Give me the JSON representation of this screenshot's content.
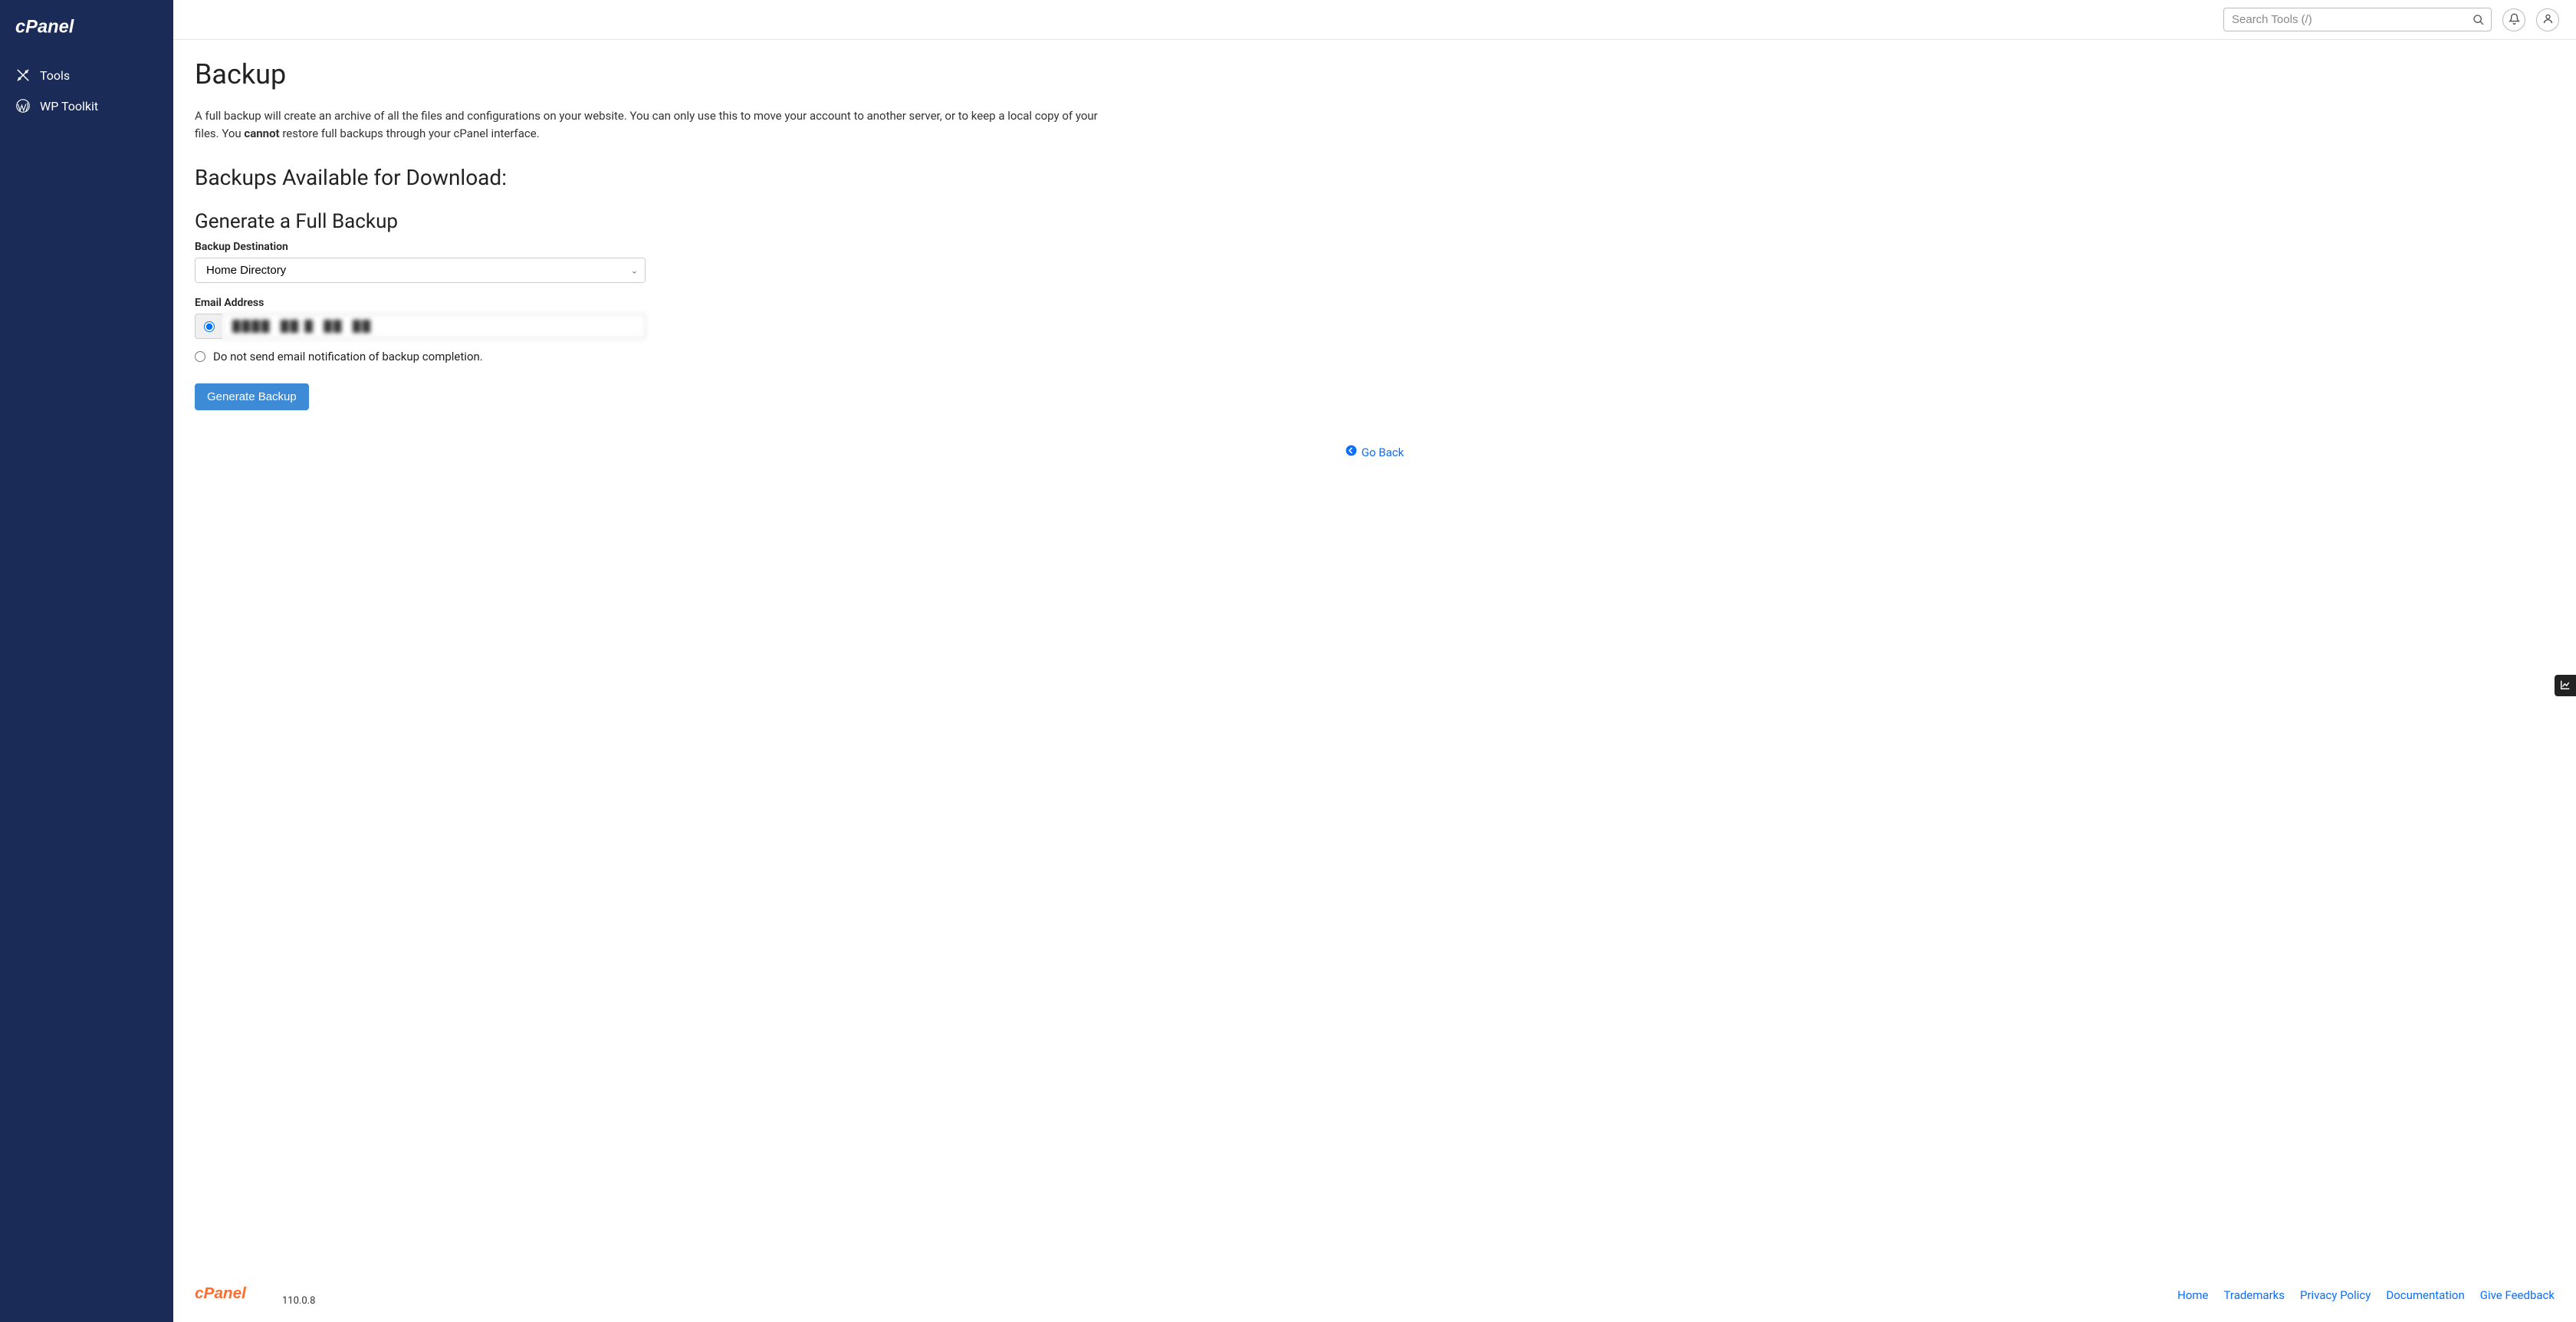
{
  "sidebar": {
    "items": [
      {
        "label": "Tools"
      },
      {
        "label": "WP Toolkit"
      }
    ]
  },
  "topbar": {
    "search_placeholder": "Search Tools (/)"
  },
  "page": {
    "title": "Backup",
    "description_prefix": "A full backup will create an archive of all the files and configurations on your website. You can only use this to move your account to another server, or to keep a local copy of your files. You ",
    "description_bold": "cannot",
    "description_suffix": " restore full backups through your cPanel interface.",
    "section_backups_available": "Backups Available for Download:",
    "section_generate": "Generate a Full Backup",
    "destination_label": "Backup Destination",
    "destination_value": "Home Directory",
    "email_label": "Email Address",
    "email_value": "████  ██ █  ██  ██",
    "no_email_label": "Do not send email notification of backup completion.",
    "generate_button": "Generate Backup",
    "go_back": "Go Back"
  },
  "footer": {
    "version": "110.0.8",
    "links": [
      "Home",
      "Trademarks",
      "Privacy Policy",
      "Documentation",
      "Give Feedback"
    ]
  }
}
